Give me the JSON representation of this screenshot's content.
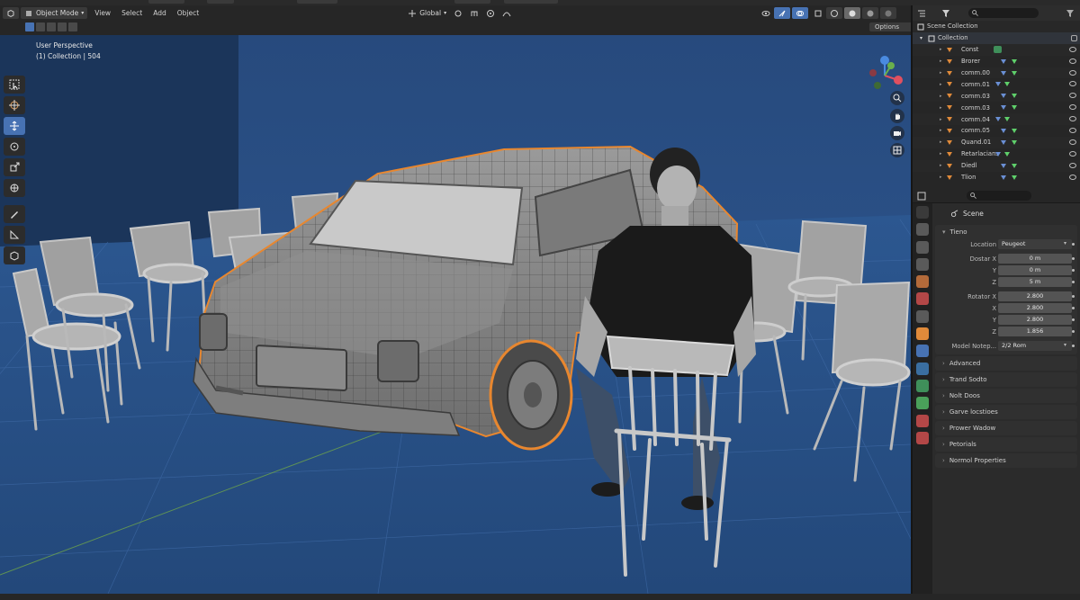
{
  "header": {
    "mode": "Object Mode",
    "menus": [
      "View",
      "Select",
      "Add",
      "Object"
    ],
    "transform_orientation": "Global",
    "options_label": "Options"
  },
  "viewport": {
    "info_line1": "User Perspective",
    "info_line2": "(1) Collection | 504",
    "background_color": "#2b4f84"
  },
  "outliner": {
    "root": "Scene Collection",
    "collection": "Collection",
    "items": [
      {
        "label": "Const",
        "kind": "light"
      },
      {
        "label": "Brorer",
        "kind": "mesh"
      },
      {
        "label": "comm.00",
        "kind": "mesh"
      },
      {
        "label": "comm.01",
        "kind": "mesh"
      },
      {
        "label": "comm.03",
        "kind": "mesh"
      },
      {
        "label": "comm.03",
        "kind": "mesh"
      },
      {
        "label": "comm.04",
        "kind": "mesh"
      },
      {
        "label": "comm.05",
        "kind": "mesh"
      },
      {
        "label": "Quand.01",
        "kind": "mesh"
      },
      {
        "label": "Retarlacians",
        "kind": "mesh"
      },
      {
        "label": "Diedl",
        "kind": "mesh"
      },
      {
        "label": "Tlion",
        "kind": "mesh"
      }
    ]
  },
  "properties": {
    "context": "Scene",
    "panel_title": "Tieno",
    "fields": [
      {
        "label": "Location",
        "value": "Peugeot",
        "select": true
      },
      {
        "label": "Dostar X",
        "value": "0 m"
      },
      {
        "label": "Y",
        "value": "0 m"
      },
      {
        "label": "Z",
        "value": "5 m"
      },
      {
        "label": "Rotator X",
        "value": "2.800"
      },
      {
        "label": "X",
        "value": "2.800"
      },
      {
        "label": "Y",
        "value": "2.800"
      },
      {
        "label": "Z",
        "value": "1.856"
      },
      {
        "label": "Model Notep...",
        "value": "2/2 Rom",
        "select": true
      }
    ],
    "collapsed_panels": [
      "Advanced",
      "Trand Sodto",
      "Nolt Doos",
      "Garve locstioes",
      "Prower Wadow",
      "Petorials",
      "Normol Properties"
    ]
  },
  "colors": {
    "accent": "#4772b3",
    "selection_outline": "#e8872f",
    "floor": "#2d5388",
    "wall_dark": "#1f3a62"
  }
}
